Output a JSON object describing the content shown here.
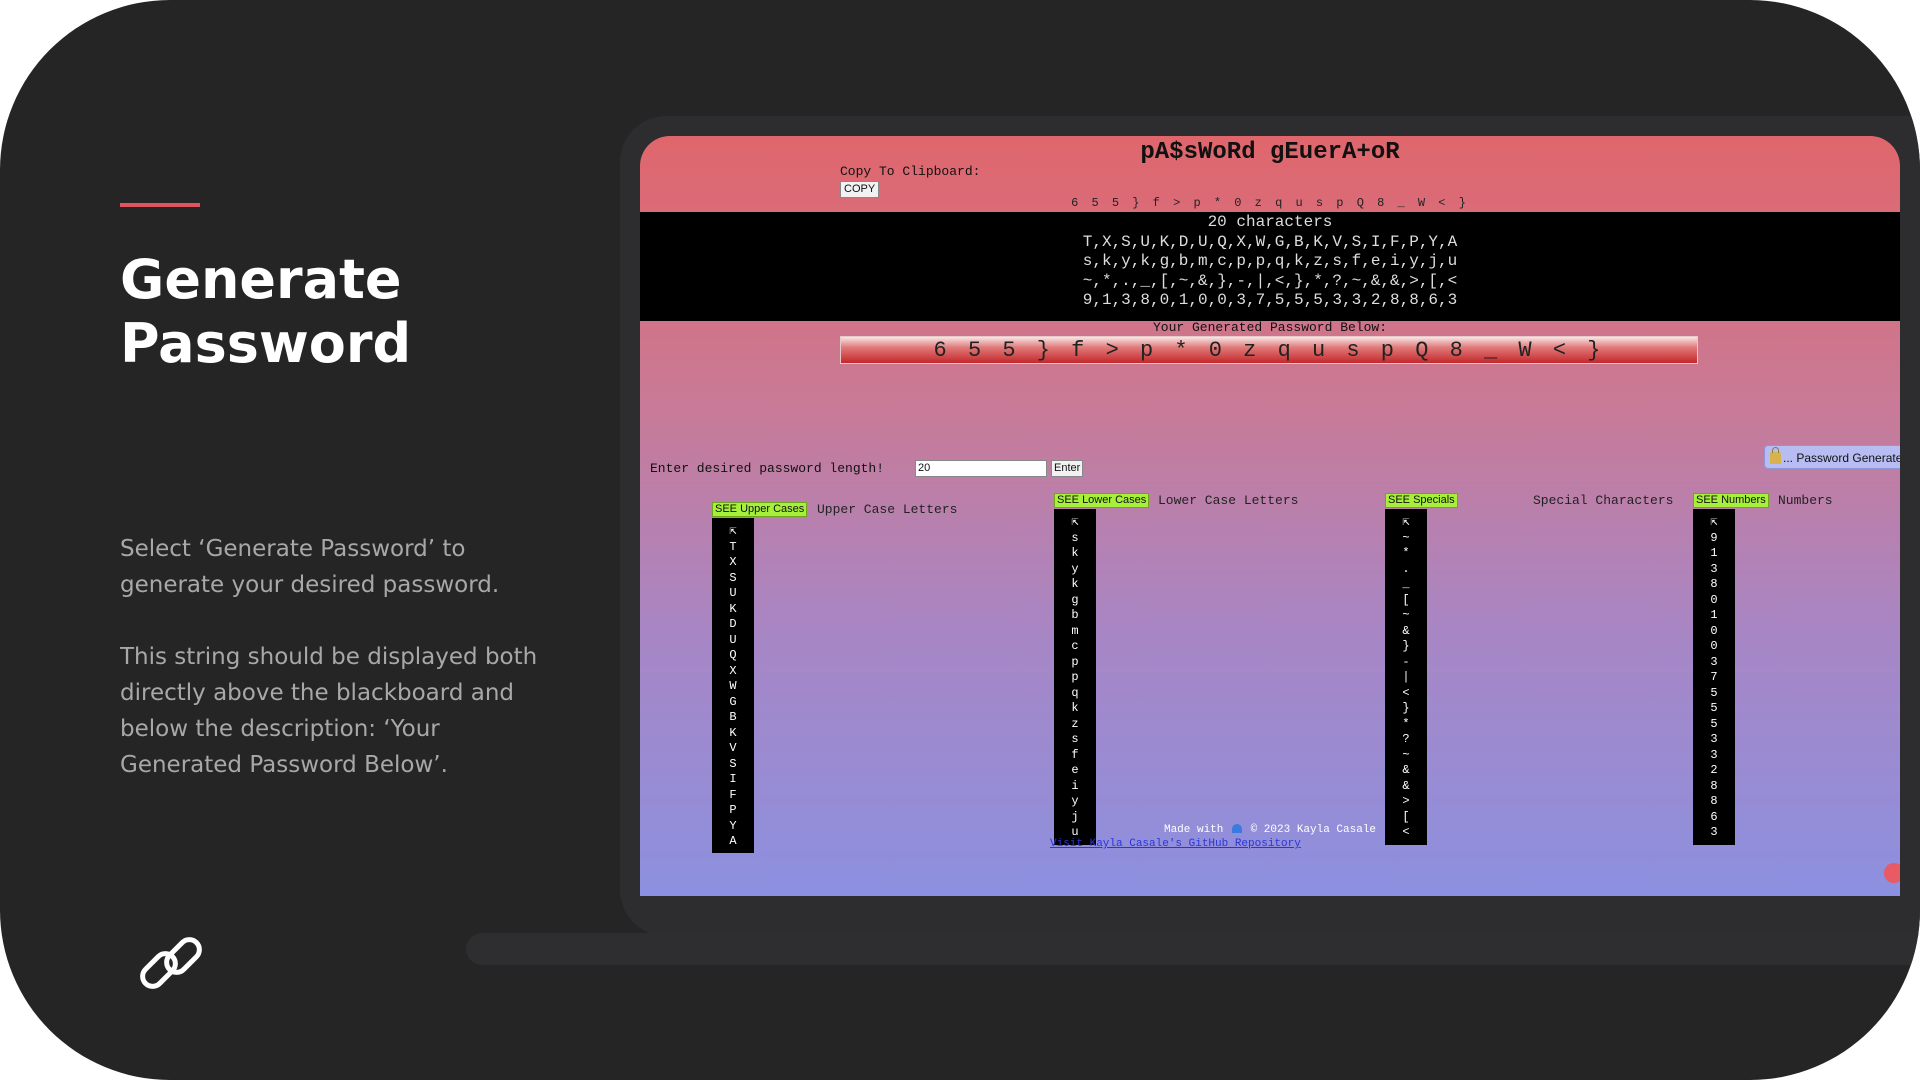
{
  "slide": {
    "title_line1": "Generate",
    "title_line2": "Password",
    "paragraph1": "Select ‘Generate Password’ to generate your desired password.",
    "paragraph2": "This string should be displayed both directly above the blackboard and below the description: ‘Your Generated Password Below’.",
    "link_icon": "link-chain-icon",
    "accent_color": "#e0555d",
    "background_color": "#252526"
  },
  "app": {
    "title": "pA$sWoRd gEuerA+oR",
    "copy_label": "Copy To Clipboard:",
    "copy_button": "COPY",
    "top_password": "6 5 5 } f > p * 0 z q u s p Q 8 _ W < }",
    "board": {
      "count": "20 characters",
      "uppercase_line": "T,X,S,U,K,D,U,Q,X,W,G,B,K,V,S,I,F,P,Y,A",
      "lowercase_line": "s,k,y,k,g,b,m,c,p,p,q,k,z,s,f,e,i,y,j,u",
      "special_line": "~,*,.,_,[,~,&,},-,|,<,},*,?,~,&,&,>,[,<",
      "numbers_line": "9,1,3,8,0,1,0,0,3,7,5,5,5,3,3,2,8,8,6,3"
    },
    "generated_label": "Your Generated Password Below:",
    "generated_password": "6 5 5 } f > p * 0 z q u s p Q 8 _ W < }",
    "length_label": "Enter desired password length!",
    "length_value": "20",
    "enter_button": "Enter",
    "side_button": "... Password Generate",
    "sections": {
      "upper": {
        "button": "SEE Upper Cases",
        "label": "Upper Case Letters",
        "chars": [
          "T",
          "X",
          "S",
          "U",
          "K",
          "D",
          "U",
          "Q",
          "X",
          "W",
          "G",
          "B",
          "K",
          "V",
          "S",
          "I",
          "F",
          "P",
          "Y",
          "A"
        ]
      },
      "lower": {
        "button": "SEE Lower Cases",
        "label": "Lower Case Letters",
        "chars": [
          "s",
          "k",
          "y",
          "k",
          "g",
          "b",
          "m",
          "c",
          "p",
          "p",
          "q",
          "k",
          "z",
          "s",
          "f",
          "e",
          "i",
          "y",
          "j",
          "u"
        ]
      },
      "special": {
        "button": "SEE Specials",
        "label": "Special Characters",
        "chars": [
          "~",
          "*",
          ".",
          "_",
          "[",
          "~",
          "&",
          "}",
          "-",
          "|",
          "<",
          "}",
          "*",
          "?",
          "~",
          "&",
          "&",
          ">",
          "[",
          "<"
        ]
      },
      "numbers": {
        "button": "SEE Numbers",
        "label": "Numbers",
        "chars": [
          "9",
          "1",
          "3",
          "8",
          "0",
          "1",
          "0",
          "0",
          "3",
          "7",
          "5",
          "5",
          "5",
          "3",
          "3",
          "2",
          "8",
          "8",
          "6",
          "3"
        ]
      }
    },
    "column_header_glyph": "⇱",
    "footer_text": "Made with",
    "footer_copyright": "© 2023 Kayla Casale",
    "github_link": "Visit Kayla Casale's GitHub Repository",
    "heart_icon": "blue-heart-icon",
    "lock_icon": "lock-icon"
  }
}
